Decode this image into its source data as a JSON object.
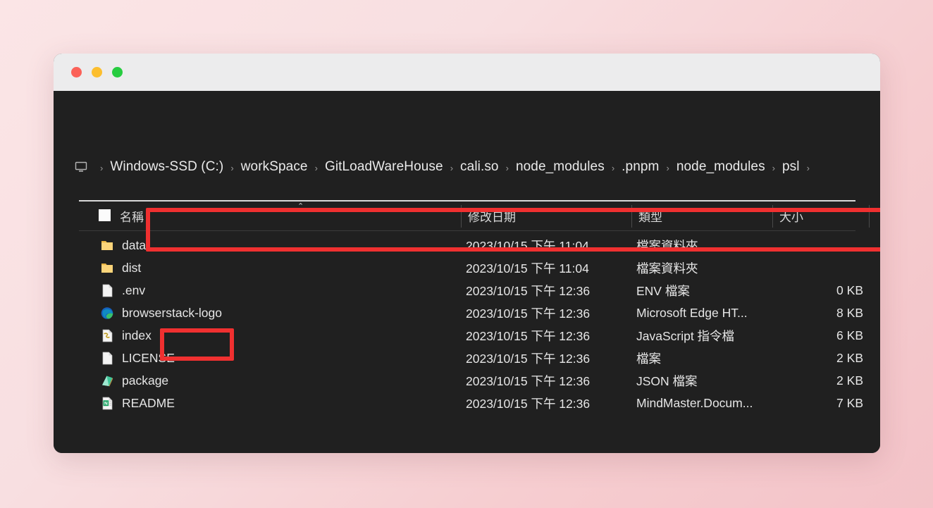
{
  "window": {
    "traffic_lights": [
      {
        "name": "close",
        "color": "#fb6158"
      },
      {
        "name": "minimize",
        "color": "#fcbe2e"
      },
      {
        "name": "maximize",
        "color": "#27cc40"
      }
    ]
  },
  "addressbar": {
    "left_icon": "computer-icon",
    "leading_separator": "›",
    "separator": "›",
    "crumbs": [
      "Windows-SSD (C:)",
      "workSpace",
      "GitLoadWareHouse",
      "cali.so",
      "node_modules",
      ".pnpm",
      "node_modules",
      "psl"
    ]
  },
  "table": {
    "select_all_checkbox": true,
    "sort_indicator": "⌃",
    "headers": {
      "name": "名稱",
      "date": "修改日期",
      "type": "類型",
      "size": "大小"
    },
    "rows": [
      {
        "name": "data",
        "icon": "folder-icon",
        "date": "2023/10/15 下午 11:04",
        "type": "檔案資料夾",
        "size": ""
      },
      {
        "name": "dist",
        "icon": "folder-icon",
        "date": "2023/10/15 下午 11:04",
        "type": "檔案資料夾",
        "size": ""
      },
      {
        "name": ".env",
        "icon": "blank-file-icon",
        "date": "2023/10/15 下午 12:36",
        "type": "ENV 檔案",
        "size": "0 KB"
      },
      {
        "name": "browserstack-logo",
        "icon": "edge-icon",
        "date": "2023/10/15 下午 12:36",
        "type": "Microsoft Edge HT...",
        "size": "8 KB"
      },
      {
        "name": "index",
        "icon": "javascript-icon",
        "date": "2023/10/15 下午 12:36",
        "type": "JavaScript 指令檔",
        "size": "6 KB"
      },
      {
        "name": "LICENSE",
        "icon": "blank-file-icon",
        "date": "2023/10/15 下午 12:36",
        "type": "檔案",
        "size": "2 KB"
      },
      {
        "name": "package",
        "icon": "json-package-icon",
        "date": "2023/10/15 下午 12:36",
        "type": "JSON 檔案",
        "size": "2 KB"
      },
      {
        "name": "README",
        "icon": "mindmaster-icon",
        "date": "2023/10/15 下午 12:36",
        "type": "MindMaster.Docum...",
        "size": "7 KB"
      }
    ]
  },
  "annotations": {
    "color": "#f03030",
    "items": [
      {
        "name": "path-highlight",
        "target": "address-bar"
      },
      {
        "name": "env-file-highlight",
        "target": ".env row"
      }
    ]
  }
}
